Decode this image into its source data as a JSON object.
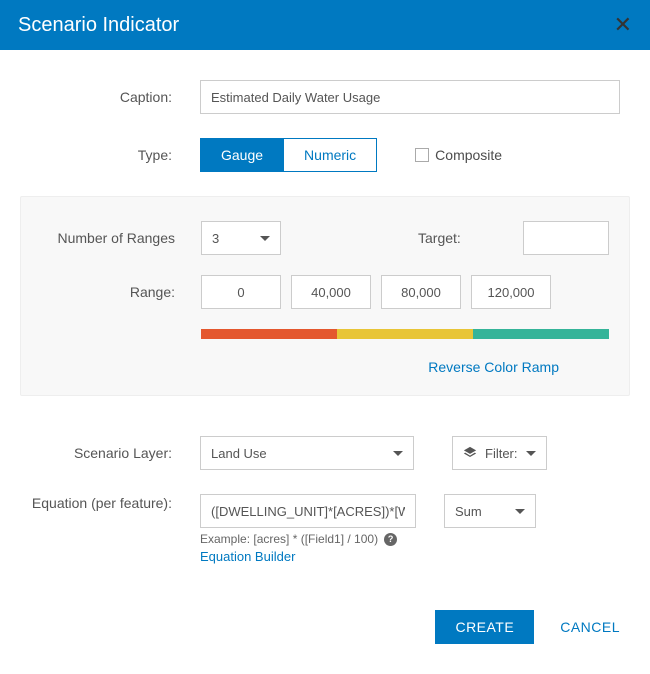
{
  "header": {
    "title": "Scenario Indicator"
  },
  "captionRow": {
    "label": "Caption:",
    "value": "Estimated Daily Water Usage"
  },
  "typeRow": {
    "label": "Type:",
    "options": {
      "gauge": "Gauge",
      "numeric": "Numeric"
    },
    "composite_label": "Composite"
  },
  "ranges": {
    "num_label": "Number of Ranges",
    "num_value": "3",
    "target_label": "Target:",
    "target_value": "",
    "range_label": "Range:",
    "values": {
      "r0": "0",
      "r1": "40,000",
      "r2": "80,000",
      "r3": "120,000"
    },
    "reverse_label": "Reverse Color Ramp"
  },
  "scenario": {
    "layer_label": "Scenario Layer:",
    "layer_value": "Land Use",
    "filter_label": "Filter:"
  },
  "equation": {
    "label": "Equation (per feature):",
    "value": "([DWELLING_UNIT]*[ACRES])*[WATE",
    "agg_value": "Sum",
    "hint": "Example: [acres] * ([Field1] / 100)",
    "builder_label": "Equation Builder"
  },
  "footer": {
    "create": "CREATE",
    "cancel": "CANCEL"
  }
}
